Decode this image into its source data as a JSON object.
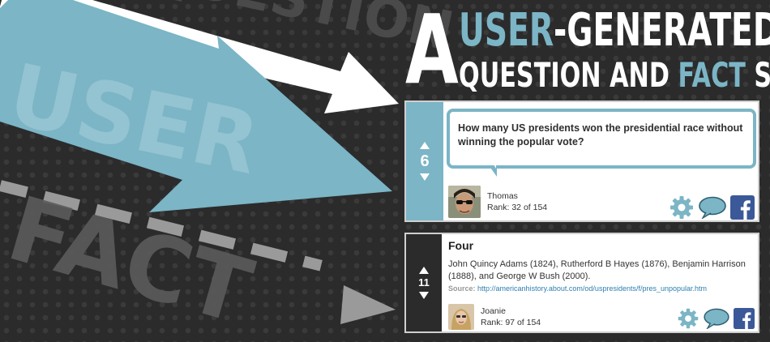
{
  "background_words": {
    "question": "QUESTION",
    "user": "USER",
    "fact": "FACT"
  },
  "headline": {
    "letter_a": "A",
    "line1_accent": "USER",
    "line1_rest": "-GENERATED",
    "line2_start": "QUESTION AND ",
    "line2_accent": "FACT",
    "line2_end": " SITE"
  },
  "question_card": {
    "votes": "6",
    "question": "How many US presidents won the presidential race without winning the popular vote?",
    "user_name": "Thomas",
    "user_rank": "Rank: 32 of 154"
  },
  "answer_card": {
    "votes": "11",
    "title": "Four",
    "body": "John Quincy Adams (1824), Rutherford B Hayes (1876), Benjamin Harrison (1888), and George W Bush (2000).",
    "source_label": "Source:",
    "source_url": "http://americanhistory.about.com/od/uspresidents/f/pres_unpopular.htm",
    "user_name": "Joanie",
    "user_rank": "Rank: 97 of 154"
  },
  "icons": [
    "gear-icon",
    "speech-bubble-icon",
    "facebook-icon",
    "thumbs-up-icon"
  ],
  "colors": {
    "accent": "#7bb5c6",
    "background": "#2b2b2c",
    "white": "#ffffff",
    "facebook": "#3b5998"
  }
}
